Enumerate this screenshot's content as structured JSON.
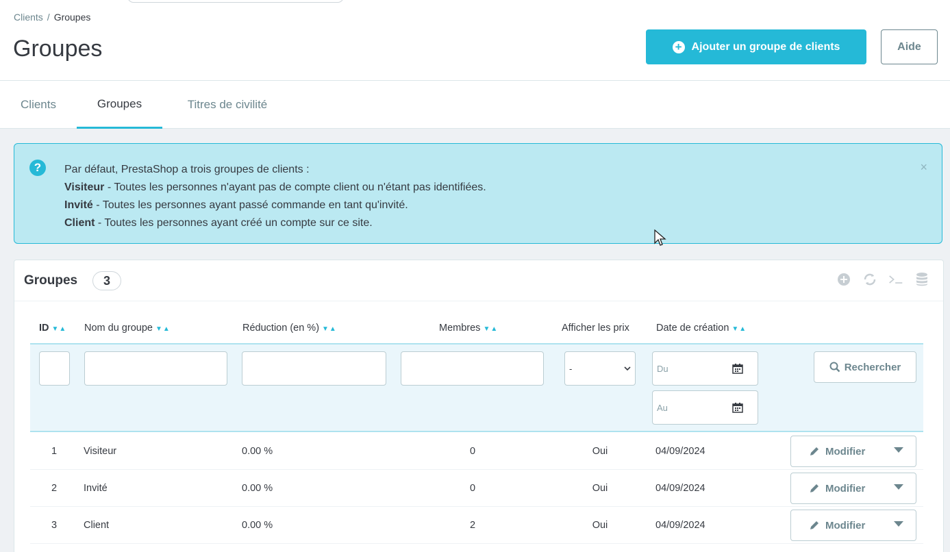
{
  "breadcrumb": {
    "parent": "Clients",
    "separator": "/",
    "current": "Groupes"
  },
  "header": {
    "title": "Groupes",
    "add_button": "Ajouter un groupe de clients",
    "help_button": "Aide"
  },
  "tabs": [
    {
      "label": "Clients",
      "active": false
    },
    {
      "label": "Groupes",
      "active": true
    },
    {
      "label": "Titres de civilité",
      "active": false
    }
  ],
  "alert": {
    "icon": "question-circle-icon",
    "close": "×",
    "intro": "Par défaut, PrestaShop a trois groupes de clients :",
    "lines": [
      {
        "term": "Visiteur",
        "text": " - Toutes les personnes n'ayant pas de compte client ou n'étant pas identifiées."
      },
      {
        "term": "Invité",
        "text": " - Toutes les personnes ayant passé commande en tant qu'invité."
      },
      {
        "term": "Client",
        "text": " - Toutes les personnes ayant créé un compte sur ce site."
      }
    ]
  },
  "panel": {
    "title": "Groupes",
    "count": "3",
    "tools": [
      "add-circle-icon",
      "refresh-icon",
      "sql-terminal-icon",
      "database-icon"
    ]
  },
  "columns": {
    "id": "ID",
    "name": "Nom du groupe",
    "reduction": "Réduction (en %)",
    "members": "Membres",
    "show_prices": "Afficher les prix",
    "date": "Date de création",
    "sort": "▼▲"
  },
  "filters": {
    "show_prices_value": "-",
    "date_from_placeholder": "Du",
    "date_to_placeholder": "Au",
    "search_button": "Rechercher"
  },
  "rows": [
    {
      "id": "1",
      "name": "Visiteur",
      "reduction": "0.00 %",
      "members": "0",
      "show_prices": "Oui",
      "date": "04/09/2024",
      "action": "Modifier"
    },
    {
      "id": "2",
      "name": "Invité",
      "reduction": "0.00 %",
      "members": "0",
      "show_prices": "Oui",
      "date": "04/09/2024",
      "action": "Modifier"
    },
    {
      "id": "3",
      "name": "Client",
      "reduction": "0.00 %",
      "members": "2",
      "show_prices": "Oui",
      "date": "04/09/2024",
      "action": "Modifier"
    }
  ],
  "colors": {
    "accent": "#25b9d7",
    "alert_bg": "#bbe9f2",
    "text": "#363a41",
    "muted": "#6c868e"
  }
}
